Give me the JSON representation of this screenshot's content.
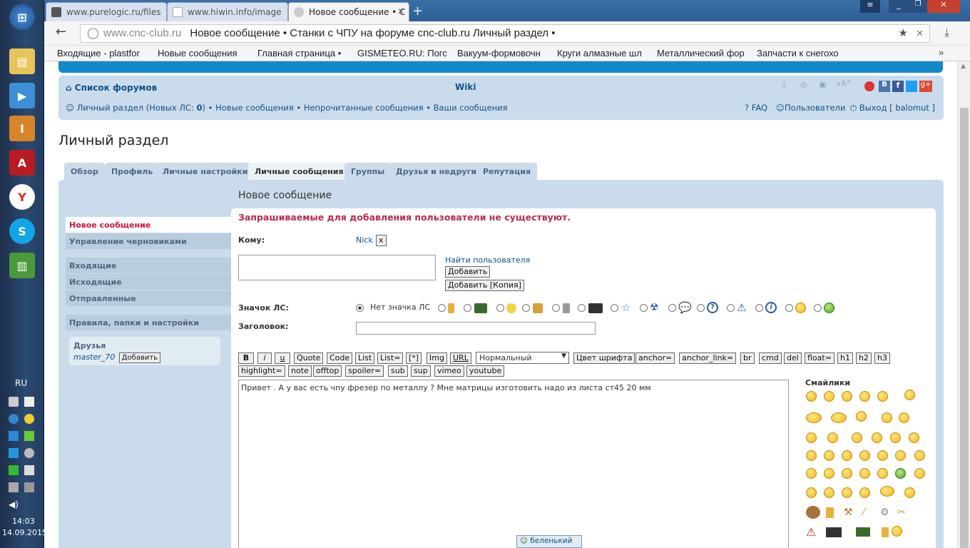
{
  "taskbar": {
    "lang": "RU",
    "time": "14:03",
    "date": "14.09.2015"
  },
  "tabs": [
    {
      "title": "www.purelogic.ru/files"
    },
    {
      "title": "www.hiwin.info/image"
    },
    {
      "title": "Новое сообщение • С"
    }
  ],
  "address": {
    "domain": "www.cnc-club.ru",
    "title": "Новое сообщение • Станки с ЧПУ на форуме cnc-club.ru Личный раздел •"
  },
  "bookmarks": [
    "Входящие - plastfor",
    "Новые сообщения",
    "Главная страница •",
    "GISMETEO.RU: Пого",
    "Вакуум-формовочн",
    "Круги алмазные шл",
    "Металлический фор",
    "Запчасти к снегохо"
  ],
  "navbar": {
    "forum_index": "Список форумов",
    "wiki": "Wiki",
    "ucp_link": "Личный раздел (Новых ЛС: ",
    "ucp_new_count": "0",
    "ucp_close": ")",
    "sep": "•",
    "new_posts": "Новые сообщения",
    "unread_posts": "Непрочитанные сообщения",
    "your_posts": "Ваши сообщения",
    "faq": "FAQ",
    "members": "Пользователи",
    "logout": "Выход [ balomut ]"
  },
  "page_title": "Личный раздел",
  "ucp_tabs": [
    "Обзор",
    "Профиль",
    "Личные настройки",
    "Личные сообщения",
    "Группы",
    "Друзья и недруги",
    "Репутация"
  ],
  "side_menu": {
    "compose": "Новое сообщение",
    "drafts": "Управление черновиками",
    "inbox": "Входящие",
    "outbox": "Исходящие",
    "sent": "Отправленные",
    "rules": "Правила, папки и настройки",
    "friends_title": "Друзья",
    "friend_name": "master_70",
    "friend_add": "Добавить"
  },
  "compose": {
    "heading": "Новое сообщение",
    "error": "Запрашиваемые для добавления пользователи не существуют.",
    "to_label": "Кому:",
    "to_user": "Nick",
    "to_remove": "x",
    "find_user": "Найти пользователя",
    "add_btn": "Добавить",
    "add_bcc_btn": "Добавить [Копия]",
    "icon_label": "Значок ЛС:",
    "no_icon": "Нет значка ЛС",
    "subject_label": "Заголовок:",
    "subject_value": "",
    "message": "Привет . А у вас есть чпу фрезер по металлу ? Мне матрицы изготовить надо из листа ст45 20 мм",
    "smilies_title": "Смайлики",
    "tooltip": "беленький"
  },
  "bbcode_row1": [
    "B",
    "i",
    "u",
    "Quote",
    "Code",
    "List",
    "List=",
    "[*]",
    "Img",
    "URL"
  ],
  "font_size_select": "Нормальный",
  "bbcode_row1b": [
    "Цвет шрифта",
    "anchor=",
    "anchor_link=",
    "br",
    "cmd",
    "del",
    "float=",
    "h1",
    "h2",
    "h3"
  ],
  "bbcode_row2": [
    "highlight=",
    "note",
    "offtop",
    "spoiler=",
    "sub",
    "sup",
    "vimeo",
    "youtube"
  ],
  "colors": {
    "accent": "#105289",
    "error": "#bc2a4d",
    "panel": "#cadceb",
    "banner": "#1289c9"
  }
}
